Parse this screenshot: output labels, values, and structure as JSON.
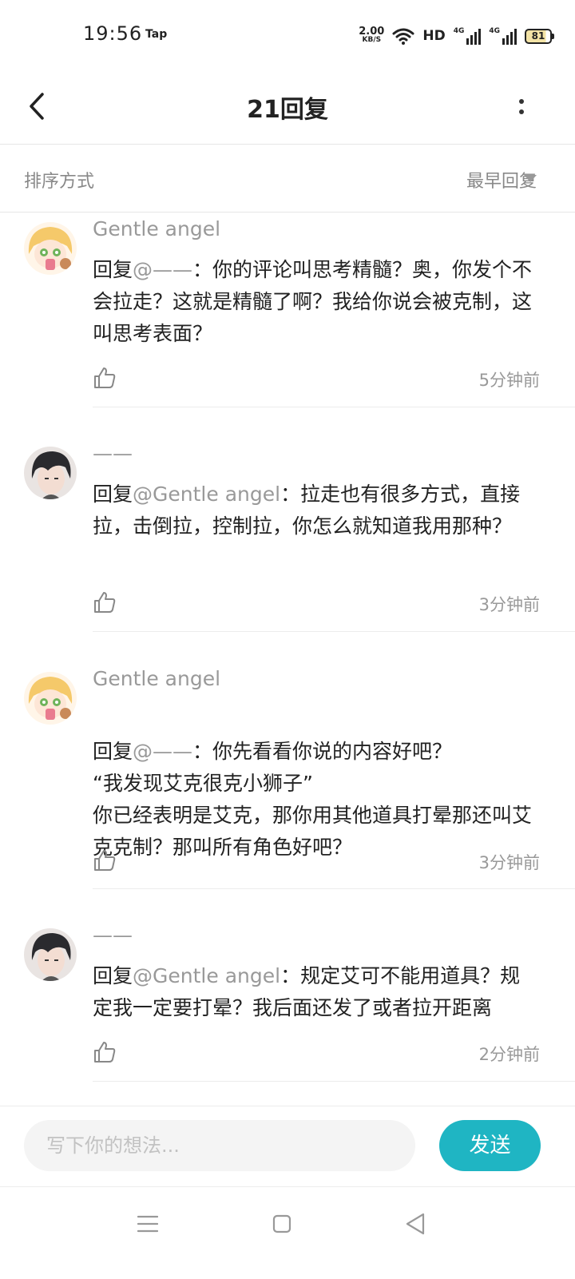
{
  "status_bar": {
    "time": "19:56",
    "app_badge": "Tap",
    "net_speed_value": "2.00",
    "net_speed_unit": "KB/S",
    "hd": "HD",
    "signal_label_1": "4G",
    "signal_label_2": "4G",
    "battery_percent": "81"
  },
  "header": {
    "title": "21回复"
  },
  "sort": {
    "label": "排序方式",
    "value": "最早回复"
  },
  "comments": [
    {
      "username": "Gentle angel",
      "reply_prefix": "回复",
      "mention": "@——",
      "text": "：你的评论叫思考精髓？奥，你发个不会拉走？这就是精髓了啊？我给你说会被克制，这叫思考表面？",
      "time": "5分钟前",
      "avatar": "anime-girl-avatar"
    },
    {
      "username": "——",
      "reply_prefix": "回复",
      "mention": "@Gentle angel",
      "text": "：拉走也有很多方式，直接拉，击倒拉，控制拉，你怎么就知道我用那种？",
      "time": "3分钟前",
      "avatar": "dark-hair-boy-avatar"
    },
    {
      "username": "Gentle angel",
      "reply_prefix": "回复",
      "mention": "@——",
      "text": "：你先看看你说的内容好吧？\n“我发现艾克很克小狮子”\n你已经表明是艾克，那你用其他道具打晕那还叫艾克克制？那叫所有角色好吧？",
      "time": "3分钟前",
      "avatar": "anime-girl-avatar"
    },
    {
      "username": "——",
      "reply_prefix": "回复",
      "mention": "@Gentle angel",
      "text": "：规定艾可不能用道具？规定我一定要打晕？我后面还发了或者拉开距离",
      "time": "2分钟前",
      "avatar": "dark-hair-boy-avatar"
    }
  ],
  "input": {
    "placeholder": "写下你的想法...",
    "send_label": "发送"
  },
  "colors": {
    "accent": "#1fb5c3",
    "muted_text": "#999999"
  }
}
